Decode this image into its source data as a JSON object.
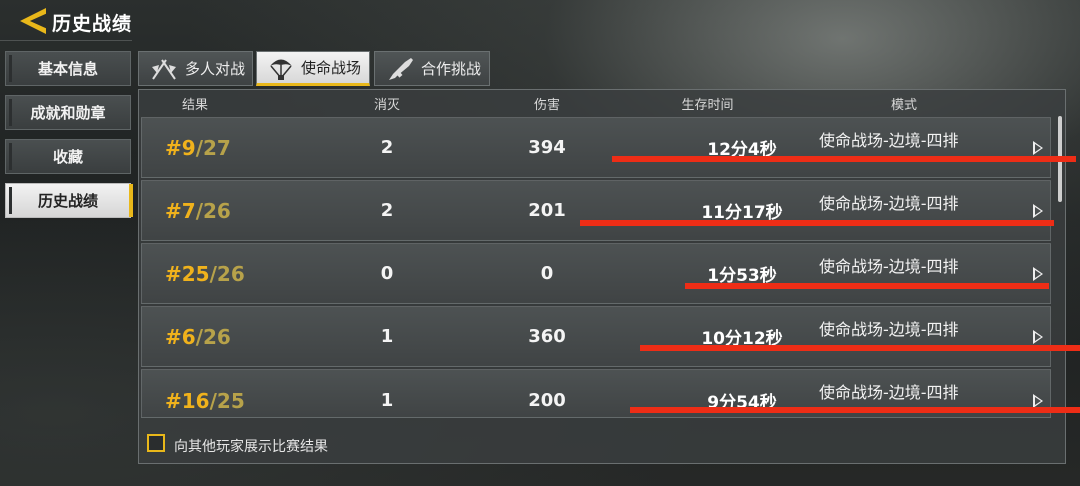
{
  "header": {
    "title": "历史战绩"
  },
  "sidebar": {
    "items": [
      {
        "label": "基本信息",
        "active": false
      },
      {
        "label": "成就和勋章",
        "active": false
      },
      {
        "label": "收藏",
        "active": false
      },
      {
        "label": "历史战绩",
        "active": true
      }
    ]
  },
  "tabs": [
    {
      "label": "多人对战",
      "icon": "crossed-flags-icon",
      "active": false
    },
    {
      "label": "使命战场",
      "icon": "parachute-icon",
      "active": true
    },
    {
      "label": "合作挑战",
      "icon": "rifle-icon",
      "active": false
    }
  ],
  "table": {
    "headers": [
      "结果",
      "消灭",
      "伤害",
      "生存时间",
      "模式"
    ],
    "rows": [
      {
        "rank": "#9",
        "total": "/27",
        "kills": "2",
        "damage": "394",
        "time": "12分4秒",
        "mode": "使命战场-边境-四排"
      },
      {
        "rank": "#7",
        "total": "/26",
        "kills": "2",
        "damage": "201",
        "time": "11分17秒",
        "mode": "使命战场-边境-四排"
      },
      {
        "rank": "#25",
        "total": "/26",
        "kills": "0",
        "damage": "0",
        "time": "1分53秒",
        "mode": "使命战场-边境-四排"
      },
      {
        "rank": "#6",
        "total": "/26",
        "kills": "1",
        "damage": "360",
        "time": "10分12秒",
        "mode": "使命战场-边境-四排"
      },
      {
        "rank": "#16",
        "total": "/25",
        "kills": "1",
        "damage": "200",
        "time": "9分54秒",
        "mode": "使命战场-边境-四排"
      }
    ]
  },
  "footer": {
    "show_results_label": "向其他玩家展示比赛结果",
    "show_results_checked": false
  },
  "colors": {
    "accent": "#e9b81a",
    "rank": "#f0b21c",
    "redaction": "#ee2d16"
  }
}
